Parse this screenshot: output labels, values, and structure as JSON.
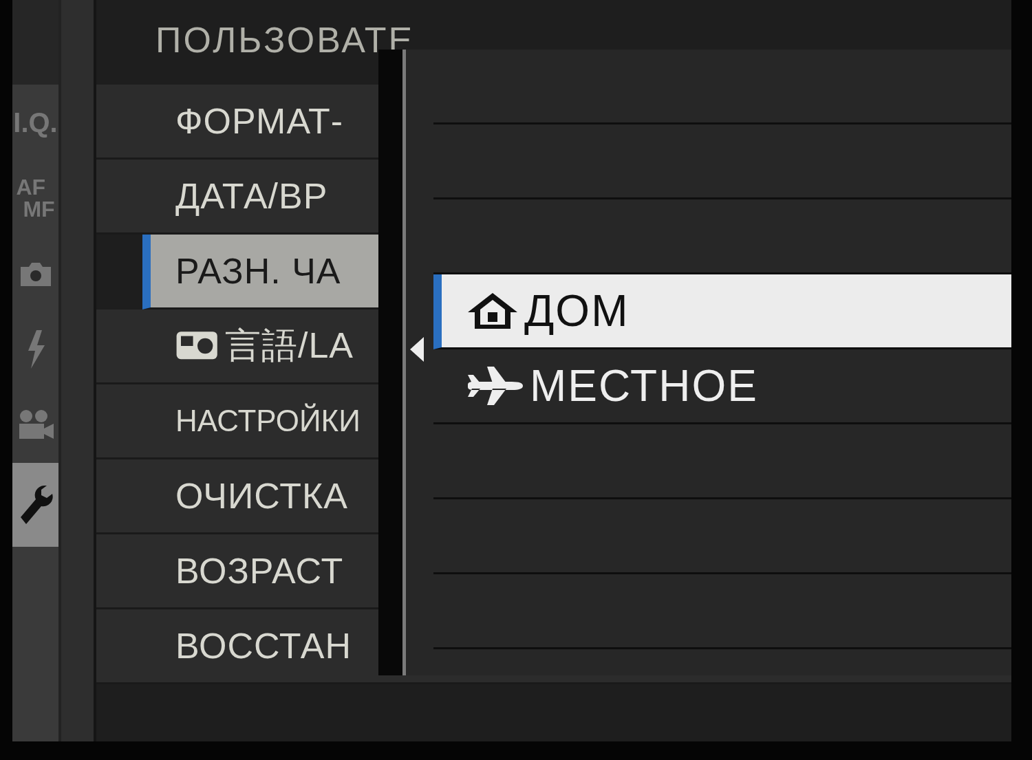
{
  "title": "ПОЛЬЗОВАТЕ",
  "side_tabs": [
    {
      "kind": "text",
      "lines": [
        "I.Q."
      ],
      "selected": false
    },
    {
      "kind": "text",
      "lines": [
        "AF",
        "MF"
      ],
      "selected": false
    },
    {
      "kind": "camera",
      "selected": false
    },
    {
      "kind": "flash",
      "selected": false
    },
    {
      "kind": "video",
      "selected": false
    },
    {
      "kind": "wrench",
      "selected": true
    }
  ],
  "menu_items": [
    {
      "kind": "plain",
      "label": "ФОРМАТ-",
      "selected": false
    },
    {
      "kind": "plain",
      "label": "ДАТА/ВР",
      "selected": false
    },
    {
      "kind": "plain",
      "label": "РАЗН. ЧА",
      "selected": true
    },
    {
      "kind": "language",
      "label": "言語/LA",
      "selected": false
    },
    {
      "kind": "small",
      "label": "НАСТРОЙКИ",
      "selected": false
    },
    {
      "kind": "plain",
      "label": "ОЧИСТКА",
      "selected": false
    },
    {
      "kind": "plain",
      "label": "ВОЗРАСТ",
      "selected": false
    },
    {
      "kind": "plain",
      "label": "ВОССТАН",
      "selected": false
    }
  ],
  "popup": {
    "options": [
      {
        "kind": "home",
        "label": "ДОМ",
        "selected": true
      },
      {
        "kind": "local",
        "label": "МЕСТНОЕ",
        "selected": false
      }
    ]
  }
}
